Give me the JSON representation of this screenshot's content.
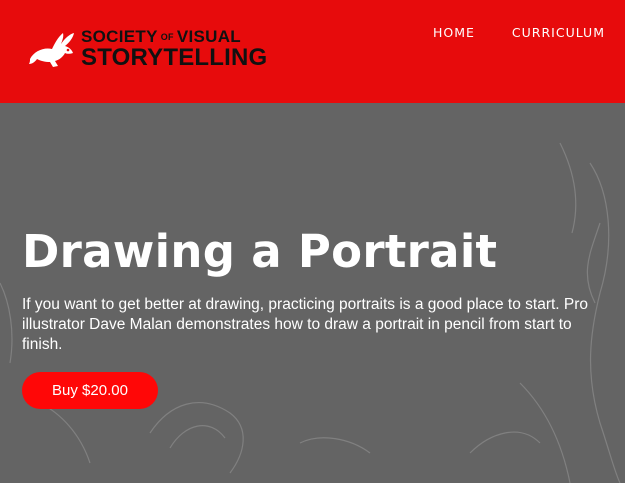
{
  "header": {
    "logo": {
      "line1_left": "SOCIETY",
      "line1_of": "OF",
      "line1_right": "VISUAL",
      "line2": "STORYTELLING",
      "icon": "rabbit-icon"
    },
    "nav": [
      "HOME",
      "CURRICULUM"
    ]
  },
  "hero": {
    "title": "Drawing a Portrait",
    "description": "If you want to get better at drawing, practicing portraits is a good place to start. Pro illustrator Dave Malan demonstrates how to draw a portrait in pencil from start to finish.",
    "buy_label": "Buy $20.00"
  },
  "colors": {
    "header_bg": "#e70b0c",
    "hero_bg": "#646464",
    "button_bg": "#ff0707",
    "text": "#ffffff"
  }
}
